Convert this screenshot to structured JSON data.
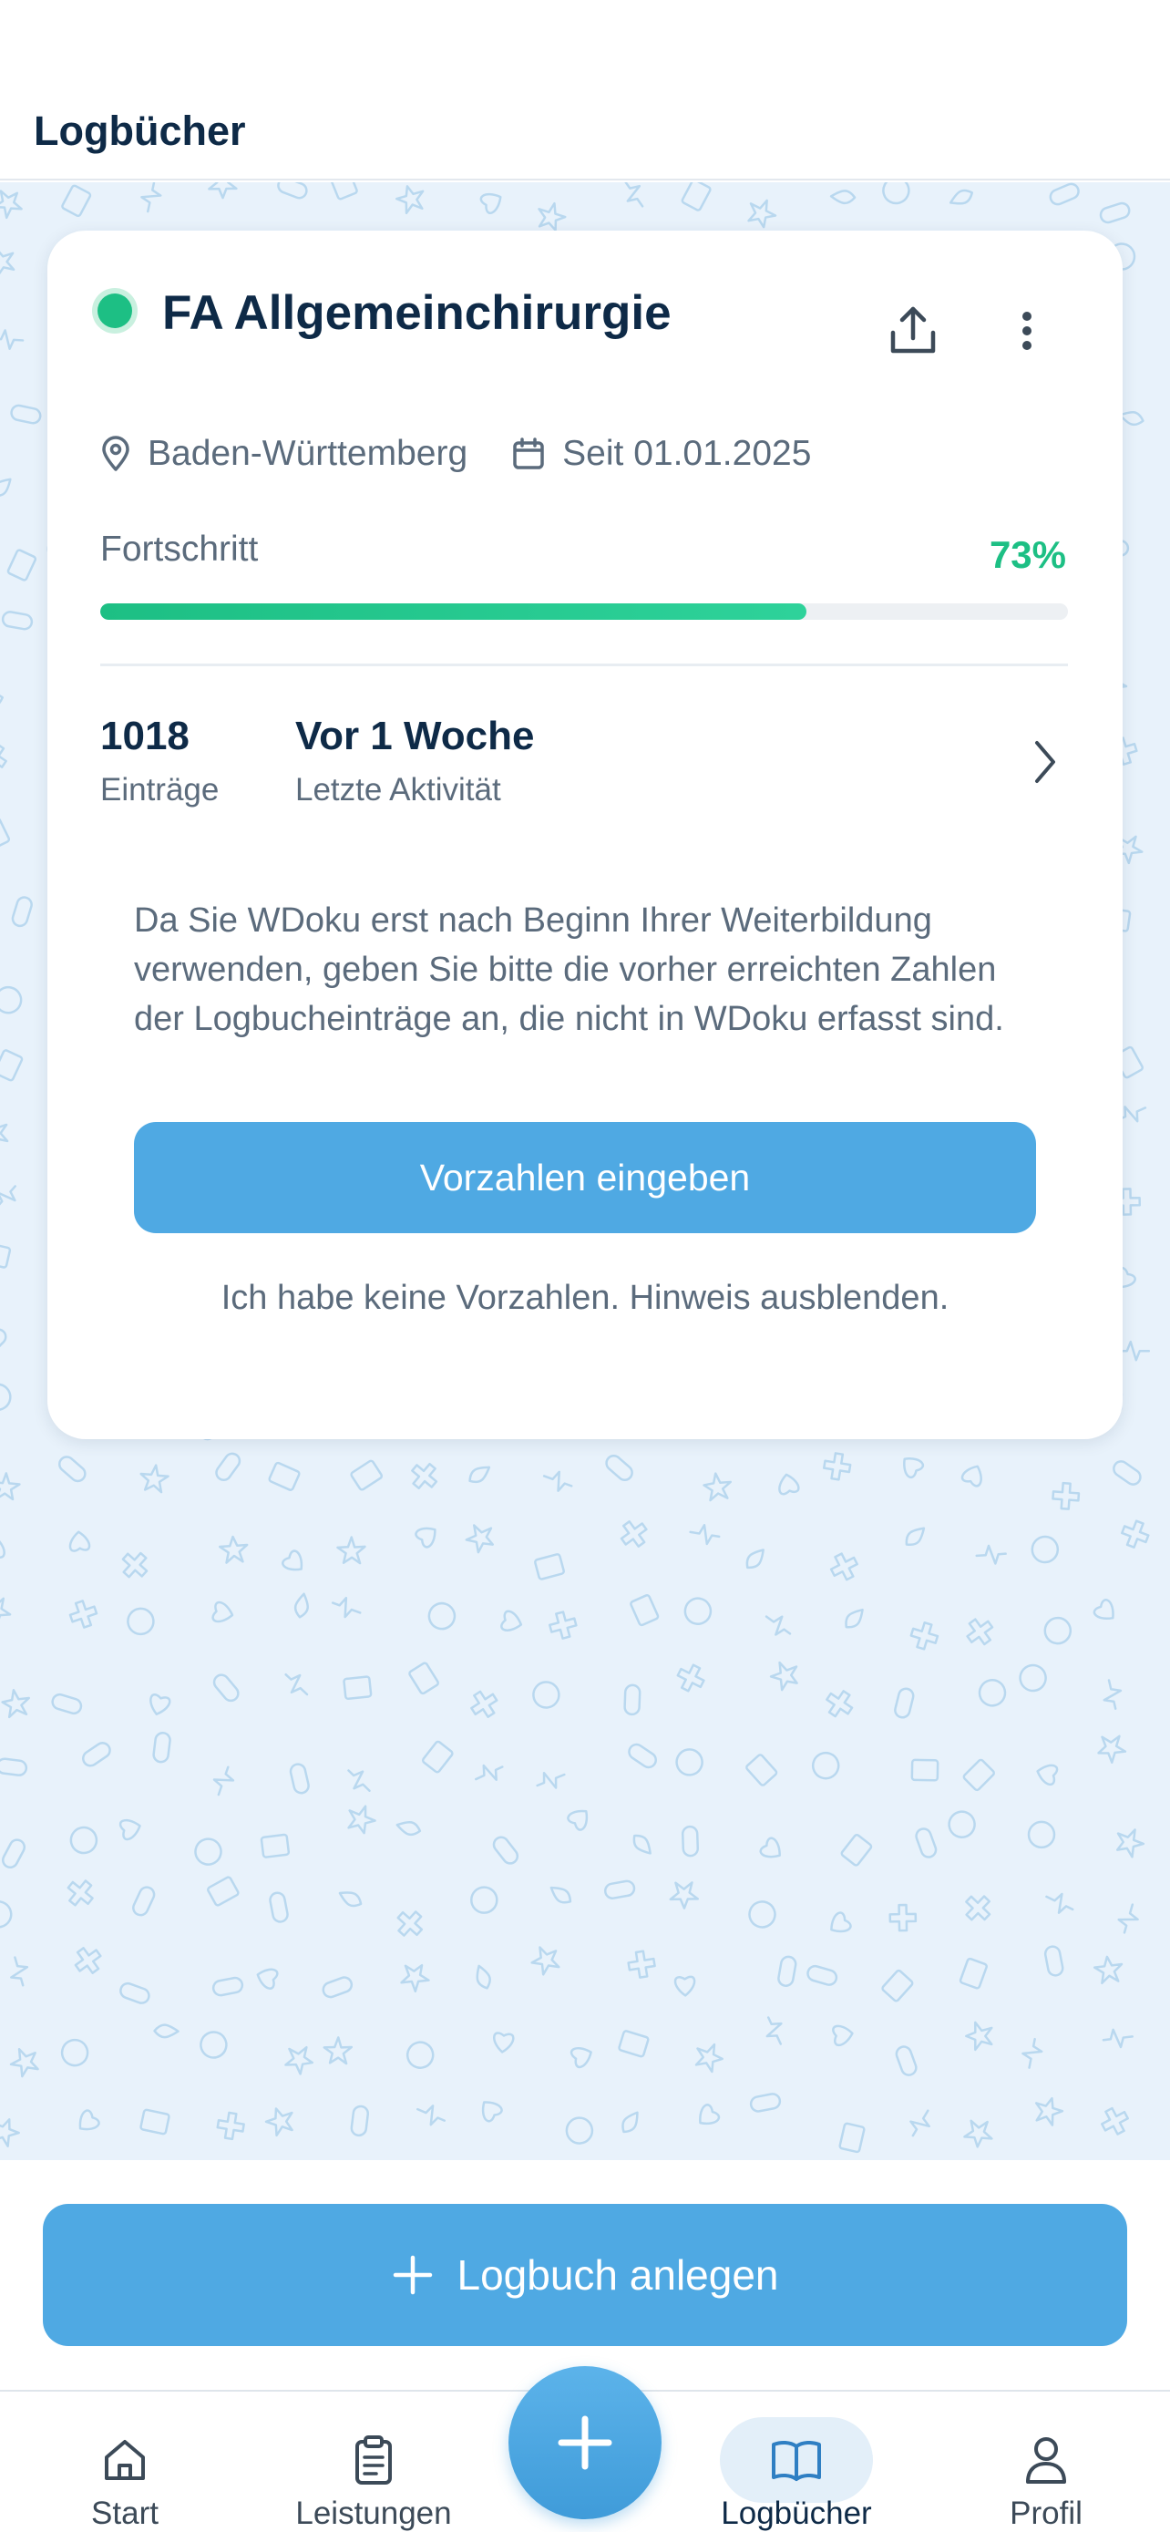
{
  "header": {
    "title": "Logbücher"
  },
  "logbook": {
    "title": "FA Allgemeinchirurgie",
    "status_color": "#1dbf84",
    "region": "Baden-Württemberg",
    "since": "Seit 01.01.2025",
    "progress_label": "Fortschritt",
    "progress_text": "73%",
    "progress_value": 0.73,
    "entries_value": "1018",
    "entries_label": "Einträge",
    "activity_value": "Vor 1 Woche",
    "activity_label": "Letzte Aktivität",
    "notice": "Da Sie WDoku erst nach Beginn Ihrer Weiterbildung verwenden, geben Sie bitte die vorher erreichten Zahlen der Logbucheinträge an, die nicht in WDoku erfasst sind.",
    "primary_button": "Vorzahlen eingeben",
    "dismiss_link": "Ich habe keine Vorzahlen. Hinweis ausblenden."
  },
  "create_button": "Logbuch anlegen",
  "tabbar": {
    "tabs": [
      {
        "label": "Start",
        "icon": "home-icon"
      },
      {
        "label": "Leistungen",
        "icon": "clipboard-icon"
      },
      {
        "label": "Logbücher",
        "icon": "book-icon",
        "active": true
      },
      {
        "label": "Profil",
        "icon": "person-icon"
      }
    ]
  },
  "colors": {
    "accent": "#4fa9e3",
    "success": "#1dbf84",
    "text": "#0e2a47",
    "muted": "#5b6b7c",
    "background": "#e8f2fb"
  }
}
